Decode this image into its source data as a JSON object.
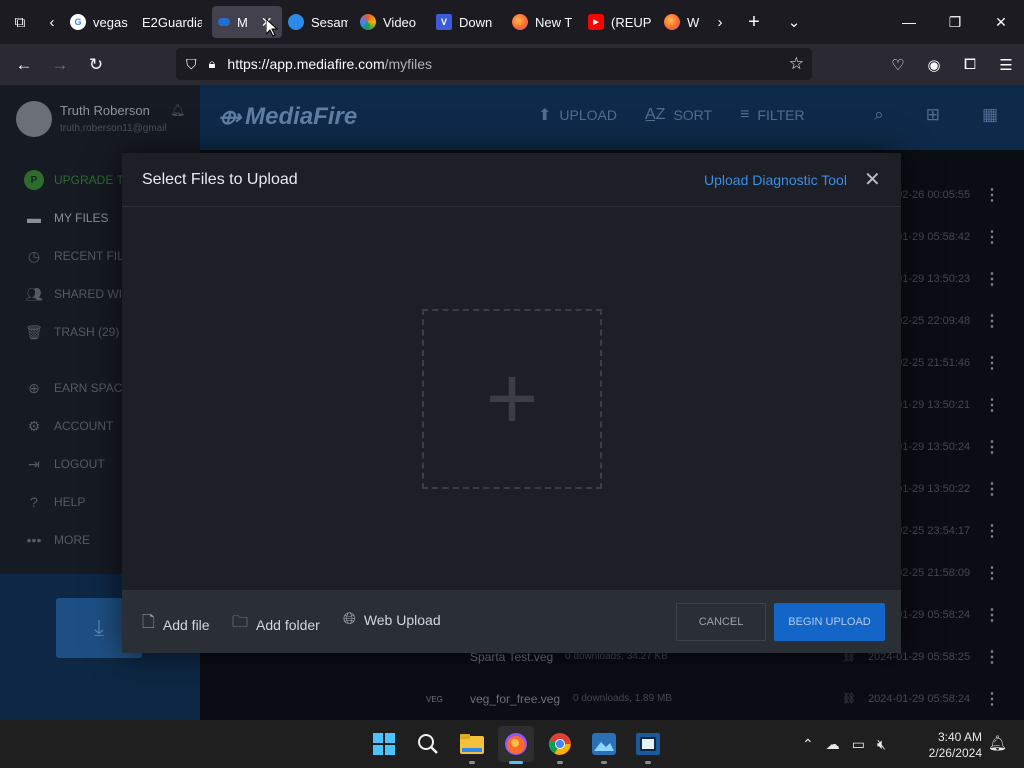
{
  "browser": {
    "tabs": [
      {
        "label": "vegas",
        "fav_color": "#ffffff",
        "fav_glyph": "G",
        "active": false
      },
      {
        "label": "E2Guardia",
        "fav_color": "",
        "fav_glyph": "",
        "active": false
      },
      {
        "label": "M",
        "fav_color": "#1f6fd1",
        "fav_glyph": "",
        "active": true
      },
      {
        "label": "Sesam",
        "fav_color": "#2d8ae8",
        "fav_glyph": "",
        "active": false
      },
      {
        "label": "Video",
        "fav_color": "#e85c2d",
        "fav_glyph": "",
        "active": false
      },
      {
        "label": "Down",
        "fav_color": "#3b5bdb",
        "fav_glyph": "V",
        "active": false
      },
      {
        "label": "New T",
        "fav_color": "#ff6a2b",
        "fav_glyph": "",
        "active": false
      },
      {
        "label": "(REUP",
        "fav_color": "#ff0000",
        "fav_glyph": "▶",
        "active": false
      },
      {
        "label": "Wh",
        "fav_color": "#ff6a2b",
        "fav_glyph": "",
        "active": false
      }
    ],
    "url_host": "https://app.mediafire.com",
    "url_path": "/myfiles"
  },
  "sidebar": {
    "user_name": "Truth Roberson",
    "user_email": "truth.roberson11@gmail",
    "items": [
      {
        "label": "UPGRADE T",
        "icon": "upgrade-icon"
      },
      {
        "label": "MY FILES",
        "icon": "folder-icon"
      },
      {
        "label": "RECENT FIL",
        "icon": "clock-icon"
      },
      {
        "label": "SHARED WI",
        "icon": "people-icon"
      },
      {
        "label": "TRASH (29)",
        "icon": "trash-icon"
      },
      {
        "label": "EARN SPAC",
        "icon": "plus-circle-icon"
      },
      {
        "label": "ACCOUNT",
        "icon": "gear-icon"
      },
      {
        "label": "LOGOUT",
        "icon": "logout-icon"
      },
      {
        "label": "HELP",
        "icon": "help-icon"
      },
      {
        "label": "MORE",
        "icon": "more-icon"
      }
    ]
  },
  "topbar": {
    "logo": "MediaFire",
    "upload": "UPLOAD",
    "sort": "SORT",
    "filter": "FILTER"
  },
  "files": {
    "dates": [
      "2024-02-26 00:05:55",
      "2024-01-29 05:58:42",
      "2024-01-29 13:50:23",
      "2024-02-25 22:09:48",
      "2024-02-25 21:51:46",
      "2024-01-29 13:50:21",
      "2024-01-29 13:50:24",
      "2024-01-29 13:50:22",
      "2024-02-25 23:54:17",
      "2024-02-25 21:58:09",
      "2024-01-29 05:58:24",
      "2024-01-29 05:58:25",
      "2024-01-29 05:58:24"
    ],
    "row_a": {
      "name": "Sparta Test.veg",
      "meta": "0 downloads, 34.27 KB"
    },
    "row_b": {
      "name": "veg_for_free.veg",
      "meta": "0 downloads, 1.89 MB",
      "type": "VEG"
    }
  },
  "modal": {
    "title": "Select Files to Upload",
    "diagnostic": "Upload Diagnostic Tool",
    "add_file": "Add file",
    "add_folder": "Add folder",
    "web_upload": "Web Upload",
    "cancel": "CANCEL",
    "begin": "BEGIN UPLOAD"
  },
  "taskbar": {
    "time": "3:40 AM",
    "date": "2/26/2024"
  },
  "colors": {
    "accent_blue": "#1366c8",
    "link_blue": "#3a8ee6"
  }
}
